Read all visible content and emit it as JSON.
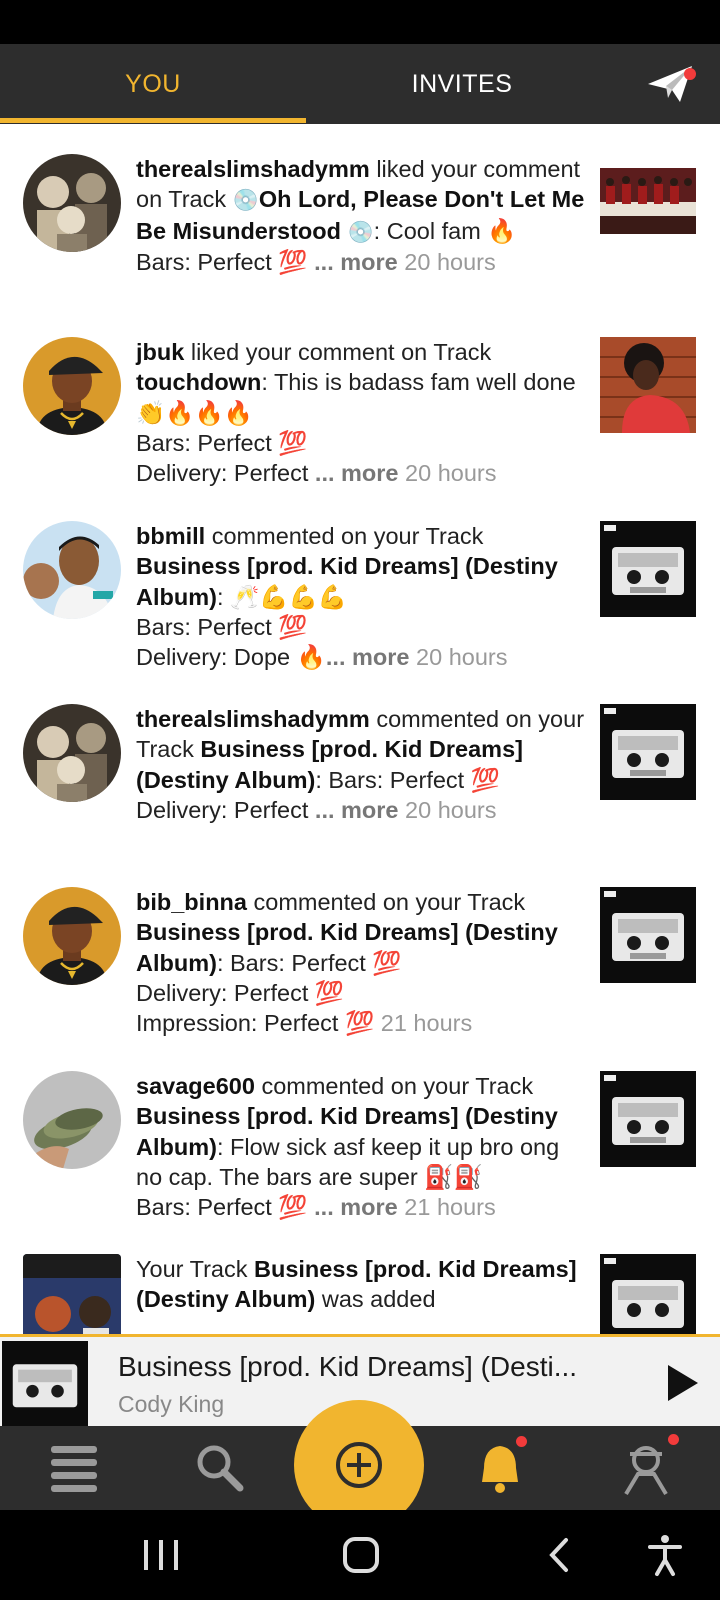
{
  "tabs": {
    "you": "YOU",
    "invites": "INVITES"
  },
  "colors": {
    "accent": "#f1b52f",
    "tabbar": "#2d2d2d",
    "notification_dot": "#f23b3b"
  },
  "feed": {
    "items": [
      {
        "user": "therealslimshadymm",
        "action": " liked your comment on Track ",
        "track": "Oh Lord, Please Don't Let Me Be Misunderstood",
        "disc": "💿",
        "comment": ": Cool fam 🔥",
        "line2": "Bars: Perfect 💯",
        "more": "... more",
        "time": " 20 hours"
      },
      {
        "user": "jbuk",
        "action": " liked your comment on Track ",
        "track": "touchdown",
        "comment": ": This is badass fam well done 👏🔥🔥🔥",
        "line2": "Bars: Perfect 💯",
        "line3": "Delivery: Perfect ",
        "more": "... more",
        "time": " 20 hours"
      },
      {
        "user": "bbmill",
        "action": " commented on your Track ",
        "track": "Business [prod. Kid Dreams] (Destiny Album)",
        "comment": ": 🥂💪💪💪",
        "line2": "Bars: Perfect 💯",
        "line3": "Delivery: Dope 🔥",
        "more": "... more",
        "time": " 20 hours"
      },
      {
        "user": "therealslimshadymm",
        "action": " commented on your Track ",
        "track": "Business [prod. Kid Dreams] (Destiny Album)",
        "comment": ": Bars: Perfect 💯",
        "line3": "Delivery: Perfect ",
        "more": "... more",
        "time": " 20 hours"
      },
      {
        "user": "bib_binna",
        "action": " commented on your Track ",
        "track": "Business [prod. Kid Dreams] (Destiny Album)",
        "comment": ": Bars: Perfect 💯",
        "line2": "Delivery: Perfect 💯",
        "line3": "Impression: Perfect 💯",
        "time": " 21 hours"
      },
      {
        "user": "savage600",
        "action": " commented on your Track ",
        "track": "Business [prod. Kid Dreams] (Destiny Album)",
        "comment": ": Flow sick asf keep it up bro ong no cap. The bars are super ⛽⛽",
        "line2": "Bars: Perfect 💯",
        "more": "... more",
        "time": " 21 hours"
      },
      {
        "prefix": "Your Track ",
        "track": "Business [prod. Kid Dreams] (Destiny Album)",
        "action": " was added"
      }
    ]
  },
  "player": {
    "title": "Business [prod. Kid Dreams] (Desti...",
    "artist": "Cody King"
  },
  "bottom_nav": {
    "items": [
      "feed-icon",
      "search-icon",
      "add-icon",
      "bell-icon",
      "profile-icon"
    ]
  }
}
